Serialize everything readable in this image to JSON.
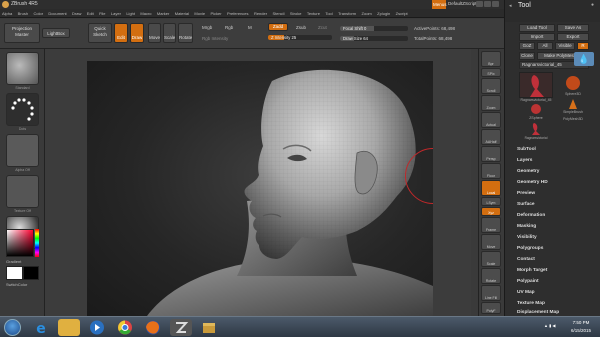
{
  "app": {
    "title": "ZBrush 4R5",
    "menus_button": "Menus",
    "default_script": "DefaultZScript"
  },
  "menubar": [
    "Alpha",
    "Brush",
    "Color",
    "Document",
    "Draw",
    "Edit",
    "File",
    "Layer",
    "Light",
    "Macro",
    "Marker",
    "Material",
    "Movie",
    "Picker",
    "Preferences",
    "Render",
    "Stencil",
    "Stroke",
    "Texture",
    "Tool",
    "Transform",
    "Zoom",
    "Zplugin",
    "Zscript"
  ],
  "toolbar": {
    "projection_master": "Projection Master",
    "lightbox": "LightBox",
    "quick_sketch": "Quick Sketch",
    "edit": "Edit",
    "draw": "Draw",
    "move": "Move",
    "scale": "Scale",
    "rotate": "Rotate",
    "mrgb": "Mrgb",
    "rgb": "Rgb",
    "m": "M",
    "rgb_intensity": "Rgb Intensity",
    "zadd": "Zadd",
    "zsub": "Zsub",
    "zcut": "Zcut",
    "z_intensity_label": "Z Intensity",
    "z_intensity_value": "25",
    "focal_shift_label": "Focal Shift",
    "focal_shift_value": "0",
    "draw_size_label": "Draw Size",
    "draw_size_value": "64",
    "active_points": "ActivePoints: 68,498",
    "total_points": "TotalPoints: 68,498"
  },
  "lefttray": {
    "standard_label": "Standard",
    "dots_label": "Dots",
    "alpha_label": "Alpha Off",
    "texture_label": "Texture Off",
    "material_label": "MatCap Gray",
    "gradient_label": "Gradient",
    "switch_color_label": "SwitchColor"
  },
  "rightshelf": [
    "Bpr",
    "SPix",
    "Scroll",
    "Zoom",
    "Actual",
    "AAHalf",
    "Persp",
    "Floor",
    "Local",
    "LSym",
    "Xyz",
    "Frame",
    "Move",
    "Scale",
    "Rotate",
    "Line Fill",
    "PolyF",
    "Transp",
    "Ghost",
    "Solo"
  ],
  "toolpanel": {
    "title": "Tool",
    "load_tool": "Load Tool",
    "save_as": "Save As",
    "import": "Import",
    "export": "Export",
    "goz": "GoZ",
    "all": "All",
    "visible": "Visible",
    "r": "R",
    "clone": "Clone",
    "make_polymesh": "Make PolyMesh3D",
    "current_tool": "Ragnarsvictorial_45",
    "tools": [
      {
        "name": "Ragnarsvictorial_45"
      },
      {
        "name": "Sphere3D"
      },
      {
        "name": "SimpleBrush"
      },
      {
        "name": "ZSphere"
      },
      {
        "name": "PolyMesh3D"
      },
      {
        "name": "Ragnarsvictorial"
      }
    ],
    "subpalettes": [
      "SubTool",
      "Layers",
      "Geometry",
      "Geometry HD",
      "Preview",
      "Surface",
      "Deformation",
      "Masking",
      "Visibility",
      "Polygroups",
      "Contact",
      "Morph Target",
      "Polypaint",
      "UV Map",
      "Texture Map",
      "Displacement Map",
      "Normal Map"
    ]
  },
  "taskbar": {
    "time": "7:50 PM",
    "date": "6/15/2015",
    "apps": [
      "start",
      "internet-explorer",
      "file-explorer",
      "media-player",
      "chrome",
      "firefox",
      "zbrush",
      "package"
    ]
  },
  "colors": {
    "accent": "#d36e10",
    "panel": "#3a3a3a",
    "dark": "#2b2b2b"
  }
}
